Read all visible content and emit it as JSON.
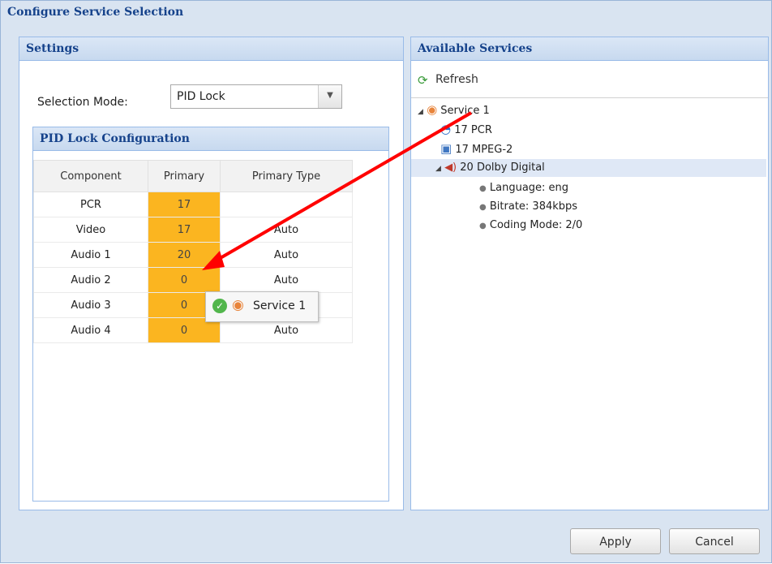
{
  "dialog": {
    "title": "Configure Service Selection"
  },
  "settings": {
    "title": "Settings",
    "mode_label": "Selection Mode:",
    "mode_value": "PID Lock",
    "pid_config": {
      "title": "PID Lock Configuration",
      "columns": [
        "Component",
        "Primary",
        "Primary Type"
      ],
      "rows": [
        {
          "component": "PCR",
          "primary": "17",
          "type": ""
        },
        {
          "component": "Video",
          "primary": "17",
          "type": "Auto"
        },
        {
          "component": "Audio 1",
          "primary": "20",
          "type": "Auto"
        },
        {
          "component": "Audio 2",
          "primary": "0",
          "type": "Auto"
        },
        {
          "component": "Audio 3",
          "primary": "0",
          "type": ""
        },
        {
          "component": "Audio 4",
          "primary": "0",
          "type": "Auto"
        }
      ]
    }
  },
  "services": {
    "title": "Available Services",
    "refresh_label": "Refresh",
    "tree": {
      "service": "Service 1",
      "pcr": "17 PCR",
      "video": "17 MPEG-2",
      "audio": "20 Dolby Digital",
      "audio_props": [
        "Language: eng",
        "Bitrate: 384kbps",
        "Coding Mode: 2/0"
      ]
    }
  },
  "drag_tooltip": {
    "label": "Service 1"
  },
  "buttons": {
    "apply": "Apply",
    "cancel": "Cancel"
  },
  "colors": {
    "primary_cell": "#fbb520",
    "header_text": "#15428b",
    "drag_arrow": "#ff0000"
  }
}
